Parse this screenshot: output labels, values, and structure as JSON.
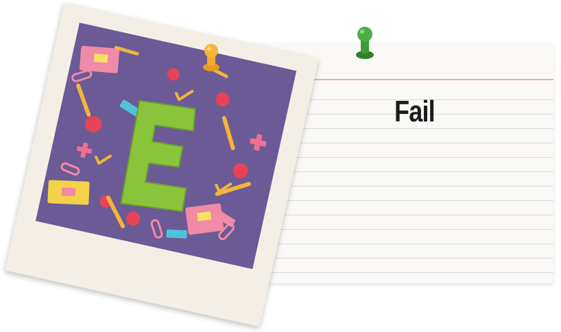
{
  "card": {
    "title": "Fail"
  },
  "photo": {
    "letter": "E",
    "colors": {
      "background": "#6b5a96",
      "letter": "#8ac43a"
    }
  },
  "pins": {
    "left_color": "#f4a92a",
    "right_color": "#3e9c3a"
  }
}
